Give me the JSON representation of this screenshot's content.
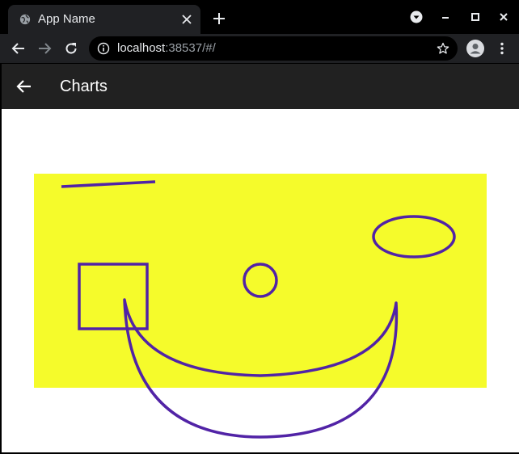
{
  "browser": {
    "tab_title": "App Name",
    "url_host": "localhost",
    "url_rest": ":38537/#/"
  },
  "appbar": {
    "title": "Charts"
  },
  "colors": {
    "canvas_background": "#f5fb2b",
    "stroke": "#5123a6",
    "appbar": "#212121"
  },
  "icons": [
    "globe-icon",
    "close-icon",
    "plus-icon",
    "back-arrow-icon",
    "forward-arrow-icon",
    "reload-icon",
    "info-icon",
    "star-icon",
    "profile-icon",
    "menu-dots-icon"
  ]
}
